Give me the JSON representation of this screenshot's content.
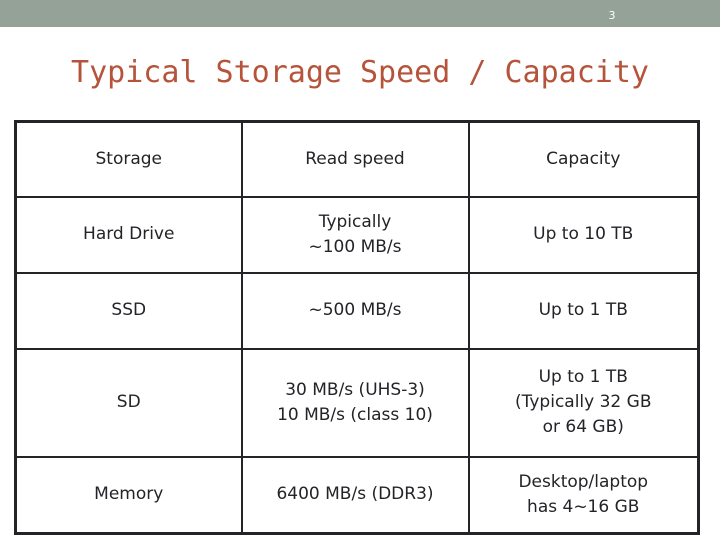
{
  "slide": {
    "page_number": "3",
    "title": "Typical Storage Speed / Capacity",
    "banner_color": "#94a298",
    "title_color": "#b5543a",
    "text_color": "#232428",
    "background_color": "#ffffff"
  },
  "table": {
    "columns": [
      "Storage",
      "Read speed",
      "Capacity"
    ],
    "rows": [
      {
        "storage": "Hard Drive",
        "read_speed": [
          "Typically",
          "~100 MB/s"
        ],
        "capacity": [
          "Up to 10 TB"
        ]
      },
      {
        "storage": "SSD",
        "read_speed": [
          "~500 MB/s"
        ],
        "capacity": [
          "Up to 1 TB"
        ]
      },
      {
        "storage": "SD",
        "read_speed": [
          "30 MB/s (UHS-3)",
          "10 MB/s (class 10)"
        ],
        "capacity": [
          "Up to 1 TB",
          "(Typically 32 GB",
          "or 64 GB)"
        ]
      },
      {
        "storage": "Memory",
        "read_speed": [
          "6400 MB/s (DDR3)"
        ],
        "capacity": [
          "Desktop/laptop",
          "has 4~16 GB"
        ]
      }
    ]
  }
}
